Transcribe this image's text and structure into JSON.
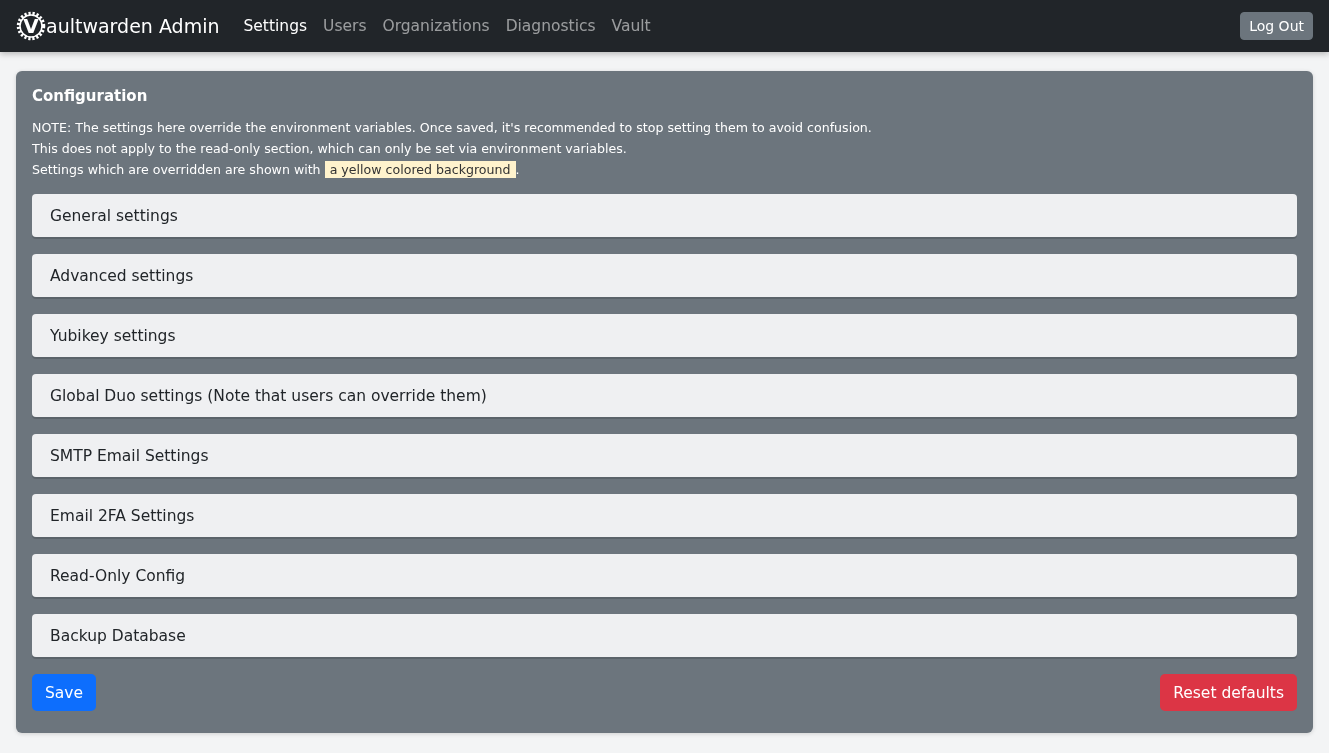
{
  "navbar": {
    "brand_letter": "V",
    "brand_text": "aultwarden Admin",
    "links": [
      {
        "label": "Settings",
        "selected": true
      },
      {
        "label": "Users",
        "selected": false
      },
      {
        "label": "Organizations",
        "selected": false
      },
      {
        "label": "Diagnostics",
        "selected": false
      },
      {
        "label": "Vault",
        "selected": false
      }
    ],
    "logout": "Log Out"
  },
  "card": {
    "title": "Configuration",
    "note_lines": [
      "NOTE: The settings here override the environment variables. Once saved, it's recommended to stop setting them to avoid confusion.",
      "This does not apply to the read-only section, which can only be set via environment variables."
    ],
    "override_line": {
      "before": "Settings which are overridden are shown with",
      "highlight": "a yellow colored background",
      "after": "."
    },
    "sections": [
      "General settings",
      "Advanced settings",
      "Yubikey settings",
      "Global Duo settings (Note that users can override them)",
      "SMTP Email Settings",
      "Email 2FA Settings",
      "Read-Only Config",
      "Backup Database"
    ],
    "save": "Save",
    "reset": "Reset defaults"
  }
}
